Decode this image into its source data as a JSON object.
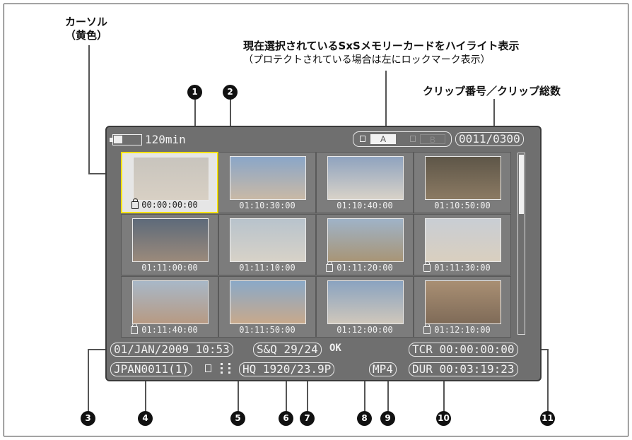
{
  "callouts": {
    "cursor_line1": "カーソル",
    "cursor_line2": "（黄色）",
    "card_title": "現在選択されているSxSメモリーカードをハイライト表示",
    "card_sub": "（プロテクトされている場合は左にロックマーク表示）",
    "clip_count": "クリップ番号／クリップ総数"
  },
  "numbers": [
    "1",
    "2",
    "3",
    "4",
    "5",
    "6",
    "7",
    "8",
    "9",
    "10",
    "11"
  ],
  "screen": {
    "battery_text": "120min",
    "card_a": "A",
    "card_b": "B",
    "clip_counter": "0011/0300",
    "clips": [
      {
        "tc": "00:00:00:00",
        "locked": true,
        "selected": true,
        "colors": [
          "#c8c4bd",
          "#d8d0c4"
        ]
      },
      {
        "tc": "01:10:30:00",
        "locked": false,
        "selected": false,
        "colors": [
          "#8aa6c8",
          "#c9b9a6"
        ]
      },
      {
        "tc": "01:10:40:00",
        "locked": false,
        "selected": false,
        "colors": [
          "#8fa3bf",
          "#d8d2c8"
        ]
      },
      {
        "tc": "01:10:50:00",
        "locked": false,
        "selected": false,
        "colors": [
          "#5e5648",
          "#8b7a63"
        ]
      },
      {
        "tc": "01:11:00:00",
        "locked": false,
        "selected": false,
        "colors": [
          "#5d6a7a",
          "#9b8a7b"
        ]
      },
      {
        "tc": "01:11:10:00",
        "locked": false,
        "selected": false,
        "colors": [
          "#b8c3cc",
          "#d7d2c8"
        ]
      },
      {
        "tc": "01:11:20:00",
        "locked": true,
        "selected": false,
        "colors": [
          "#9fb3c8",
          "#a89576"
        ]
      },
      {
        "tc": "01:11:30:00",
        "locked": true,
        "selected": false,
        "colors": [
          "#c9ced4",
          "#d9cfbf"
        ]
      },
      {
        "tc": "01:11:40:00",
        "locked": true,
        "selected": false,
        "colors": [
          "#a8b8c8",
          "#b79a83"
        ]
      },
      {
        "tc": "01:11:50:00",
        "locked": false,
        "selected": false,
        "colors": [
          "#8aa9c8",
          "#c8a98c"
        ]
      },
      {
        "tc": "01:12:00:00",
        "locked": false,
        "selected": false,
        "colors": [
          "#8aa3c0",
          "#cfc7bb"
        ]
      },
      {
        "tc": "01:12:10:00",
        "locked": true,
        "selected": false,
        "colors": [
          "#a98f73",
          "#7f6b58"
        ]
      }
    ],
    "date": "01/JAN/2009 10:53",
    "sq": "S&Q 29/24",
    "ok": "OK",
    "tcr": "TCR 00:00:00:00",
    "clip_name": "JPAN0011(1)",
    "format": "HQ 1920/23.9P",
    "codec": "MP4",
    "dur": "DUR 00:03:19:23"
  },
  "colors": {
    "cursor": "#f6e200",
    "screen_bg": "#6f6f6f"
  }
}
